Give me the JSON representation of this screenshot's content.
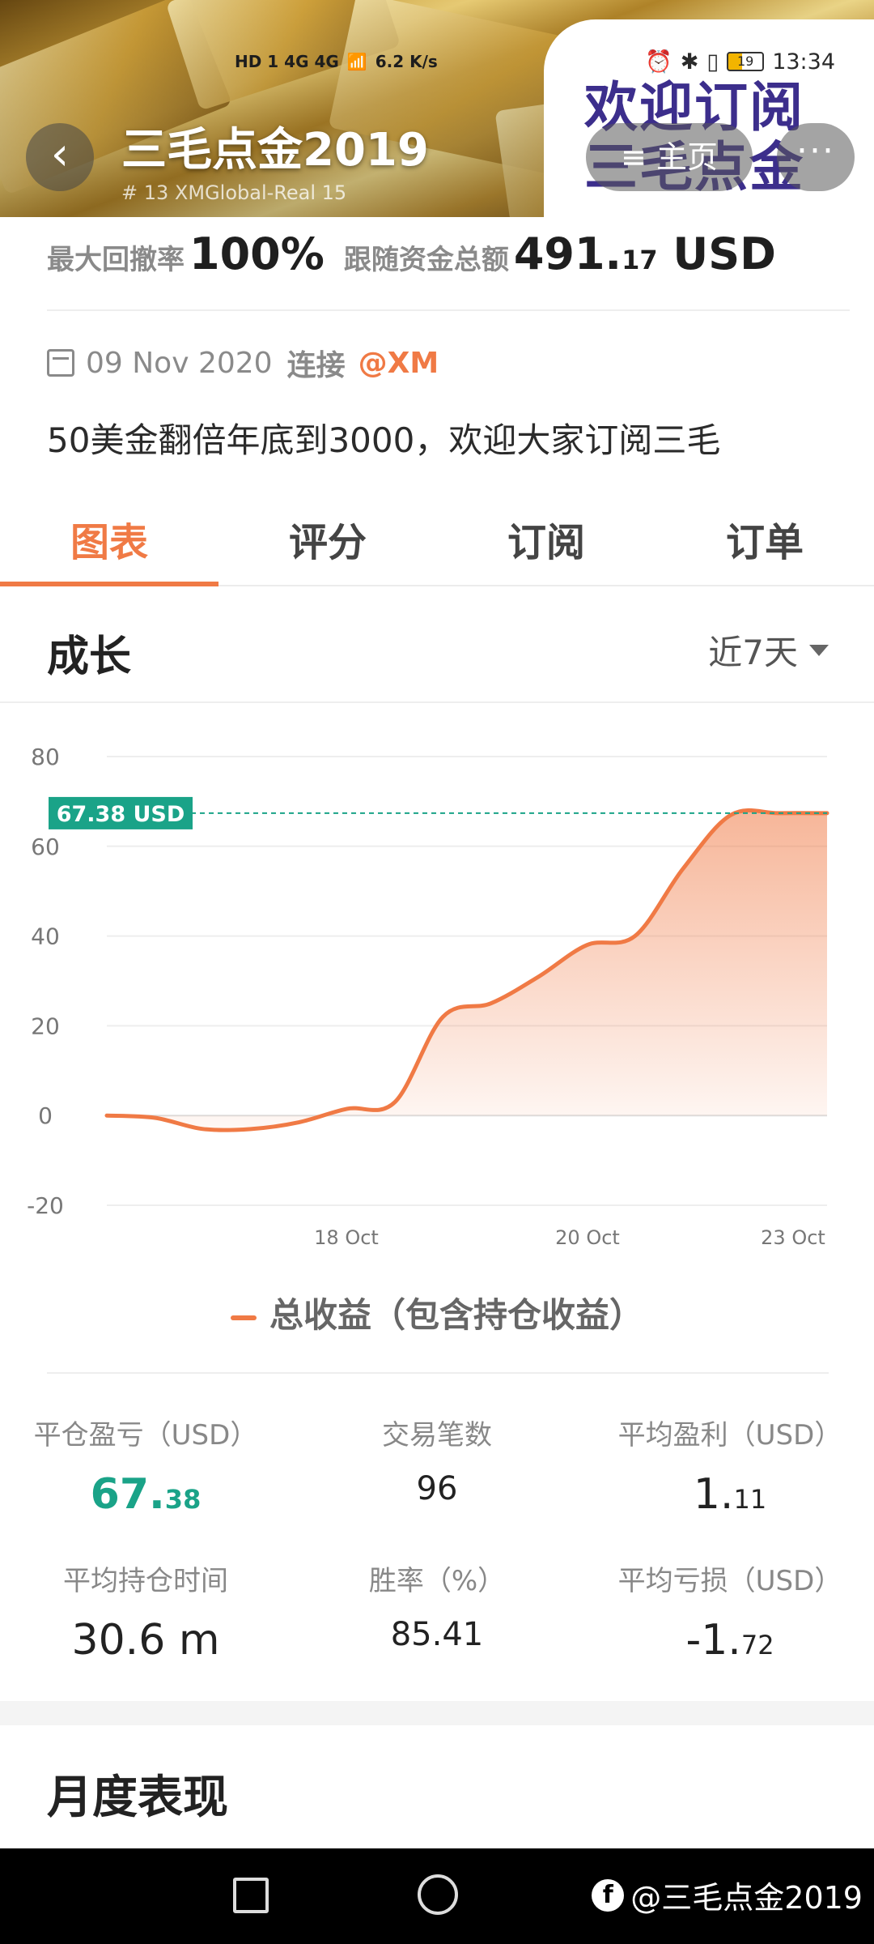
{
  "status_bar": {
    "network_left": "HD 1  4G  4G",
    "speed": "6.2 K/s",
    "battery": "19",
    "time": "13:34"
  },
  "header": {
    "title": "三毛点金2019",
    "subtitle": "# 13  XMGlobal-Real 15",
    "promo_text": "欢迎订阅\n三毛点金",
    "home_label": "主页",
    "more_label": "···"
  },
  "summary": {
    "max_drawdown_label": "最大回撤率",
    "max_drawdown_value": "100%",
    "follow_funds_label": "跟随资金总额",
    "follow_funds_int": "491.",
    "follow_funds_dec": "17",
    "follow_funds_unit": "USD"
  },
  "info": {
    "date": "09 Nov 2020",
    "connect_label": "连接",
    "broker": "@XM",
    "description": "50美金翻倍年底到3000，欢迎大家订阅三毛"
  },
  "tabs": [
    "图表",
    "评分",
    "订阅",
    "订单"
  ],
  "growth": {
    "title": "成长",
    "period": "近7天"
  },
  "chart_data": {
    "type": "area",
    "title": "",
    "xlabel": "",
    "ylabel": "",
    "ylim": [
      -20,
      80
    ],
    "yticks": [
      80,
      60,
      40,
      20,
      0,
      -20
    ],
    "xticks": [
      "18 Oct",
      "20 Oct",
      "23 Oct"
    ],
    "current_label": "67.38 USD",
    "current_value": 67.38,
    "series": [
      {
        "name": "总收益（包含持仓收益）",
        "color": "#f07a45",
        "x": [
          "16 Oct",
          "16 Oct",
          "17 Oct",
          "17 Oct",
          "17 Oct",
          "18 Oct",
          "18 Oct",
          "19 Oct",
          "19 Oct",
          "19 Oct",
          "20 Oct",
          "20 Oct",
          "21 Oct",
          "21 Oct",
          "22 Oct",
          "23 Oct"
        ],
        "values": [
          0,
          -0.5,
          -3,
          -3,
          -1.5,
          1.5,
          3,
          22,
          25,
          31,
          38,
          40,
          55,
          67,
          67.38,
          67.38
        ]
      }
    ],
    "grid": true,
    "legend": "bottom"
  },
  "legend_label": "总收益（包含持仓收益）",
  "stats": {
    "closed_pl_label": "平仓盈亏（USD）",
    "closed_pl_int": "67.",
    "closed_pl_dec": "38",
    "trades_label": "交易笔数",
    "trades_value": "96",
    "avg_profit_label": "平均盈利（USD）",
    "avg_profit_int": "1.",
    "avg_profit_dec": "11",
    "avg_hold_label": "平均持仓时间",
    "avg_hold_value": "30.6 m",
    "win_rate_label": "胜率（%）",
    "win_rate_value": "85.41",
    "avg_loss_label": "平均亏损（USD）",
    "avg_loss_int": "-1.",
    "avg_loss_dec": "72"
  },
  "monthly": {
    "title": "月度表现"
  },
  "watermark": "@三毛点金2019",
  "colors": {
    "accent": "#f07a45",
    "positive": "#1aa388",
    "promo": "#3c2e8c"
  }
}
